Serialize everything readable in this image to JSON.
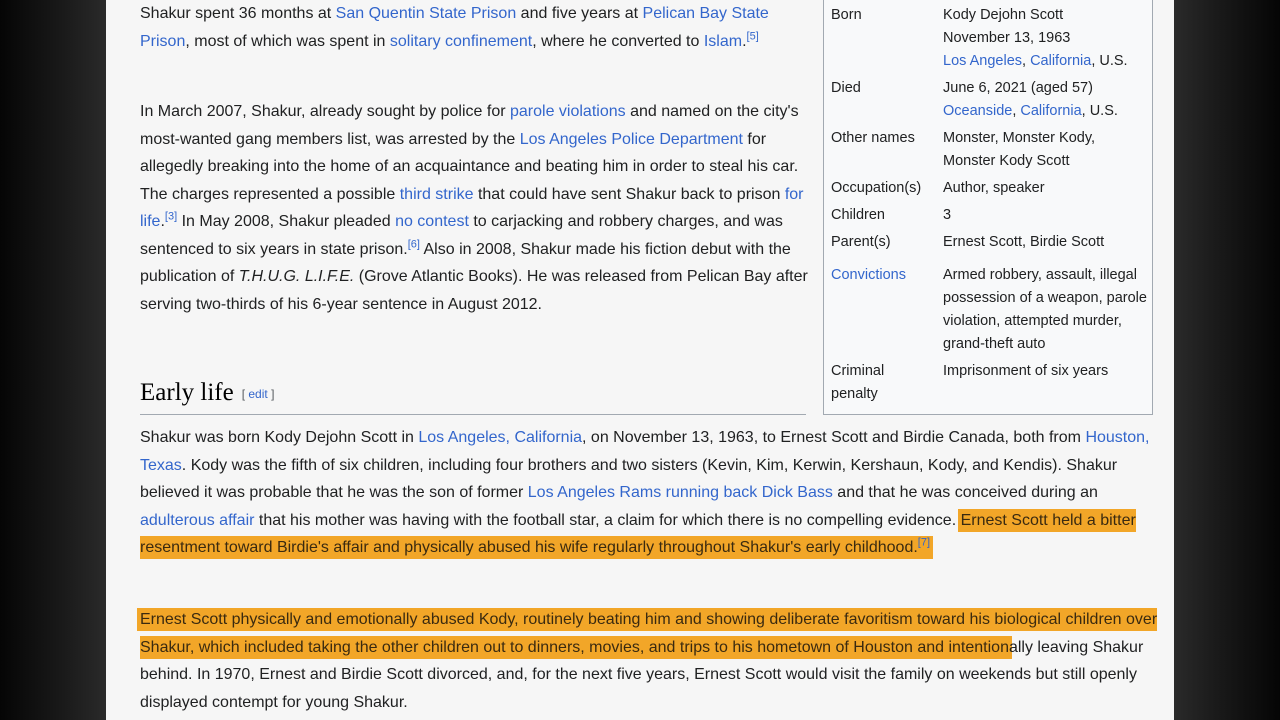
{
  "paragraphs": {
    "p1": {
      "t1": "Shakur spent 36 months at ",
      "l1": "San Quentin State Prison",
      "t2": " and five years at ",
      "l2": "Pelican Bay State Prison",
      "t3": ", most of which was spent in ",
      "l3": "solitary confinement",
      "t4": ", where he converted to ",
      "l4": "Islam",
      "t5": ".",
      "r1": "[5]"
    },
    "p2": {
      "t1": "In March 2007, Shakur, already sought by police for ",
      "l1": "parole violations",
      "t2": " and named on the city's most-wanted gang members list, was arrested by the ",
      "l2": "Los Angeles Police Department",
      "t3": " for allegedly breaking into the home of an acquaintance and beating him in order to steal his car. The charges represented a possible ",
      "l3": "third strike",
      "t4": " that could have sent Shakur back to prison ",
      "l4": "for life",
      "t5": ".",
      "r1": "[3]",
      "t6": " In May 2008, Shakur pleaded ",
      "l5": "no contest",
      "t7": " to carjacking and robbery charges, and was sentenced to six years in state prison.",
      "r2": "[6]",
      "t8": " Also in 2008, Shakur made his fiction debut with the publication of ",
      "i1": "T.H.U.G. L.I.F.E.",
      "t9": " (Grove Atlantic Books). He was released from Pelican Bay after serving two-thirds of his 6-year sentence in August 2012."
    },
    "p3": {
      "t1": "Shakur was born Kody Dejohn Scott in ",
      "l1": "Los Angeles, California",
      "t2": ", on November 13, 1963, to Ernest Scott and Birdie Canada, both from ",
      "l2": "Houston, Texas",
      "t3": ". Kody was the fifth of six children, including four brothers and two sisters (Kevin, Kim, Kerwin, Kershaun, Kody, and Kendis). Shakur believed it was probable that he was the son of former ",
      "l3": "Los Angeles Rams",
      "t4": " ",
      "l4": "running back",
      "t5": " ",
      "l5": "Dick Bass",
      "t6": " and that he was conceived during an ",
      "l6": "adulterous affair",
      "t7": " that his mother was having with the football star, a claim for which there is no compelling evidence. ",
      "h1": "Ernest Scott held a bitter resentment toward Birdie's affair and physically abused his wife regularly throughout Shakur's early childhood.",
      "r1": "[7]"
    },
    "p4": {
      "h1": "Ernest Scott physically and emotionally abused Kody, routinely beating him and showing deliberate favoritism toward his biological children over Shakur, which included taking the other children out to dinners, movies, and trips to his hometown of Houston and intention",
      "t1": "ally leaving Shakur behind. In 1970, Ernest and Birdie Scott divorced, and, for the next five years, Ernest Scott would visit the family on weekends but still openly displayed contempt for young Shakur."
    }
  },
  "section": {
    "title": "Early life",
    "edit_open": "[ ",
    "edit_label": "edit",
    "edit_close": " ]"
  },
  "infobox": {
    "born_label": "Born",
    "born_name": "Kody Dejohn Scott",
    "born_date": "November 13, 1963",
    "born_city": "Los Angeles",
    "born_sep": ", ",
    "born_state": "California",
    "born_country": ", U.S.",
    "died_label": "Died",
    "died_date": "June 6, 2021 (aged 57)",
    "died_city": "Oceanside",
    "died_sep": ", ",
    "died_state": "California",
    "died_country": ", U.S.",
    "other_label": "Other names",
    "other_value": "Monster, Monster Kody, Monster Kody Scott",
    "occupation_label": "Occupation(s)",
    "occupation_value": "Author, speaker",
    "children_label": "Children",
    "children_value": "3",
    "parents_label": "Parent(s)",
    "parents_value": "Ernest Scott, Birdie Scott",
    "convictions_label": "Convictions",
    "convictions_value": "Armed robbery, assault, illegal possession of a weapon, parole violation, attempted murder, grand-theft auto",
    "penalty_label": "Criminal penalty",
    "penalty_value": "Imprisonment of six years"
  },
  "colors": {
    "link": "#3366cc",
    "highlight": "#f2a628",
    "page_bg": "#f6f6f6"
  }
}
